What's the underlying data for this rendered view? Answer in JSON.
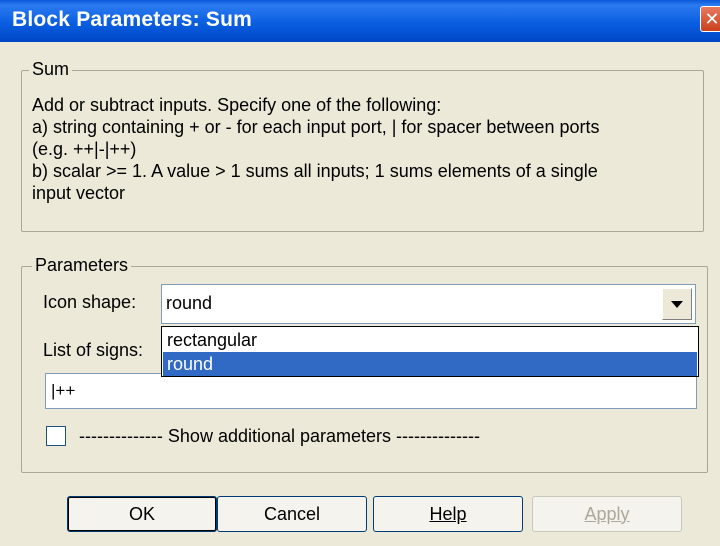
{
  "window": {
    "title": "Block Parameters: Sum",
    "close_glyph": "✕"
  },
  "sum_group": {
    "label": "Sum",
    "description": [
      "Add or subtract inputs.  Specify one of the following:",
      "a) string containing + or - for each input port, | for spacer between ports",
      "(e.g. ++|-|++)",
      "b) scalar >= 1. A value > 1 sums all inputs; 1 sums elements of a single",
      "input vector"
    ]
  },
  "params_group": {
    "label": "Parameters",
    "icon_shape": {
      "label": "Icon shape:",
      "value": "round",
      "options": [
        "rectangular",
        "round"
      ],
      "selected_index": 1
    },
    "list_of_signs": {
      "label": "List of signs:",
      "value": "|++"
    },
    "show_additional": {
      "label": "-------------- Show additional parameters --------------",
      "checked": false
    }
  },
  "buttons": {
    "ok": "OK",
    "cancel": "Cancel",
    "help": "Help",
    "apply": "Apply"
  },
  "icons": {
    "close": "close-icon",
    "dropdown": "chevron-down-icon"
  }
}
